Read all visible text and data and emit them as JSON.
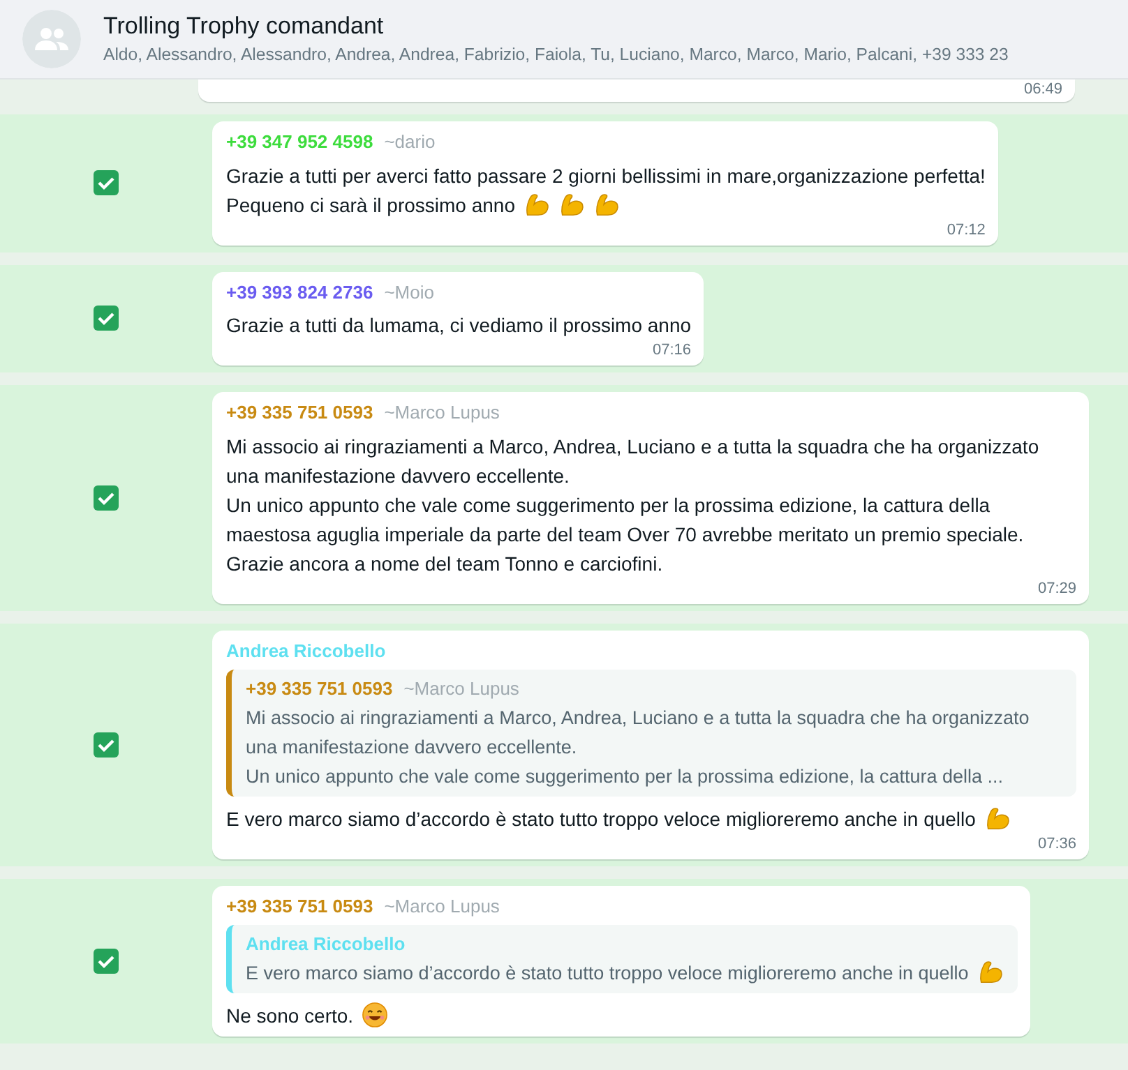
{
  "header": {
    "title": "Trolling Trophy comandant",
    "participants": "Aldo, Alessandro, Alessandro, Andrea, Andrea, Fabrizio, Faiola, Tu, Luciano, Marco, Marco, Mario, Palcani, +39 333 23"
  },
  "cut_message": {
    "time": "06:49"
  },
  "messages": [
    {
      "selected": true,
      "sender": "+39 347 952 4598",
      "color": "#3ddc3d",
      "alias": "~dario",
      "lines": [
        "Grazie a tutti per averci fatto passare 2 giorni bellissimi in mare,organizzazione perfetta!",
        "Pequeno ci sarà il prossimo anno"
      ],
      "emojis": [
        {
          "kind": "biceps"
        },
        {
          "kind": "biceps"
        },
        {
          "kind": "biceps"
        }
      ],
      "time": "07:12"
    },
    {
      "selected": true,
      "sender": "+39 393 824 2736",
      "color": "#6a5cf0",
      "alias": "~Moio",
      "lines": [
        "Grazie a tutti da lumama, ci vediamo il prossimo anno"
      ],
      "time": "07:16"
    },
    {
      "selected": true,
      "sender": "+39 335 751 0593",
      "color": "#c88a12",
      "alias": "~Marco Lupus",
      "lines": [
        "Mi associo ai ringraziamenti a Marco, Andrea, Luciano e a tutta la squadra che ha organizzato una manifestazione davvero eccellente.",
        "Un unico appunto che vale come suggerimento per la prossima edizione, la cattura della maestosa aguglia imperiale da parte del team Over 70 avrebbe meritato un premio speciale.",
        "Grazie ancora a nome del team Tonno e carciofini."
      ],
      "time": "07:29"
    },
    {
      "selected": true,
      "sender": "Andrea Riccobello",
      "color": "#5ee0f0",
      "quote": {
        "sender": "+39 335 751 0593",
        "color": "#c88a12",
        "alias": "~Marco Lupus",
        "lines": [
          "Mi associo ai ringraziamenti a Marco, Andrea, Luciano e a tutta la squadra che ha organizzato una manifestazione davvero eccellente.",
          "Un unico appunto che vale come suggerimento per la prossima edizione, la cattura della ..."
        ]
      },
      "lines": [
        "E vero marco siamo d’accordo è stato tutto troppo veloce miglioreremo anche in quello"
      ],
      "emojis": [
        {
          "kind": "biceps"
        }
      ],
      "time": "07:36"
    },
    {
      "selected": true,
      "sender": "+39 335 751 0593",
      "color": "#c88a12",
      "alias": "~Marco Lupus",
      "quote": {
        "sender": "Andrea Riccobello",
        "color": "#5ee0f0",
        "lines": [
          "E vero marco siamo d’accordo è stato tutto troppo veloce miglioreremo anche in quello"
        ],
        "emojis": [
          {
            "kind": "biceps"
          }
        ]
      },
      "lines": [
        "Ne sono certo."
      ],
      "emojis": [
        {
          "kind": "smile"
        }
      ]
    }
  ]
}
